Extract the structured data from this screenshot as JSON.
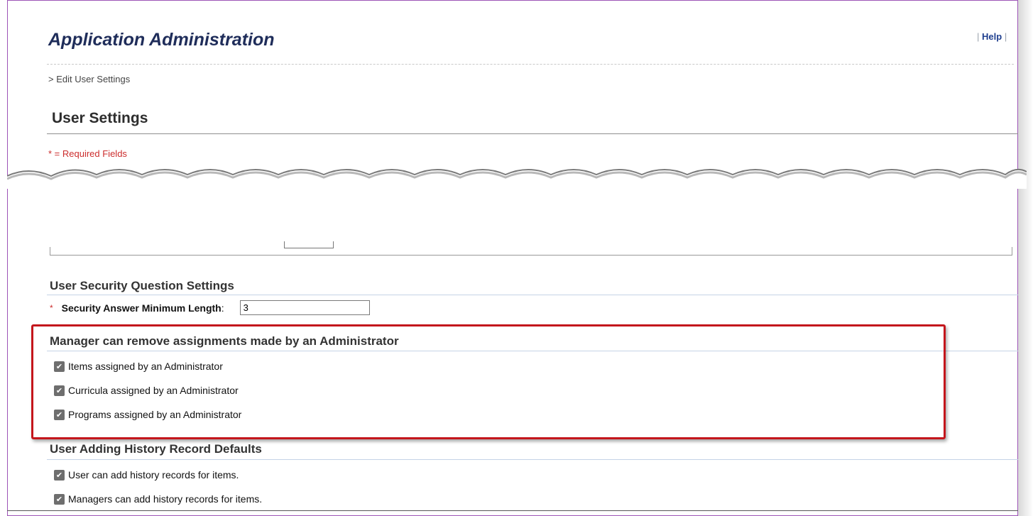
{
  "header": {
    "app_title": "Application Administration",
    "help_separator_left": "|",
    "help_label": "Help",
    "help_separator_right": "|"
  },
  "breadcrumb": "> Edit User Settings",
  "page_title": "User Settings",
  "required_note": "* = Required Fields",
  "security_section": {
    "title": "User Security Question Settings",
    "field": {
      "required_mark": "*",
      "label": "Security Answer Minimum Length",
      "colon": ":",
      "value": "3"
    }
  },
  "manager_section": {
    "title": "Manager can remove assignments made by an Administrator",
    "options": [
      {
        "label": "Items assigned by an Administrator",
        "checked": true
      },
      {
        "label": "Curricula assigned by an Administrator",
        "checked": true
      },
      {
        "label": "Programs assigned by an Administrator",
        "checked": true
      }
    ]
  },
  "history_section": {
    "title": "User Adding History Record Defaults",
    "options": [
      {
        "label": "User can add history records for items.",
        "checked": true
      },
      {
        "label": "Managers can add history records for items.",
        "checked": true
      }
    ]
  },
  "colors": {
    "frame_border": "#9d54b7",
    "title_navy": "#1f2d5a",
    "required_red": "#cc2d2d",
    "highlight_red": "#c4161c",
    "section_rule": "#c5d3e6"
  },
  "icons": {
    "checkbox": "check-icon"
  }
}
